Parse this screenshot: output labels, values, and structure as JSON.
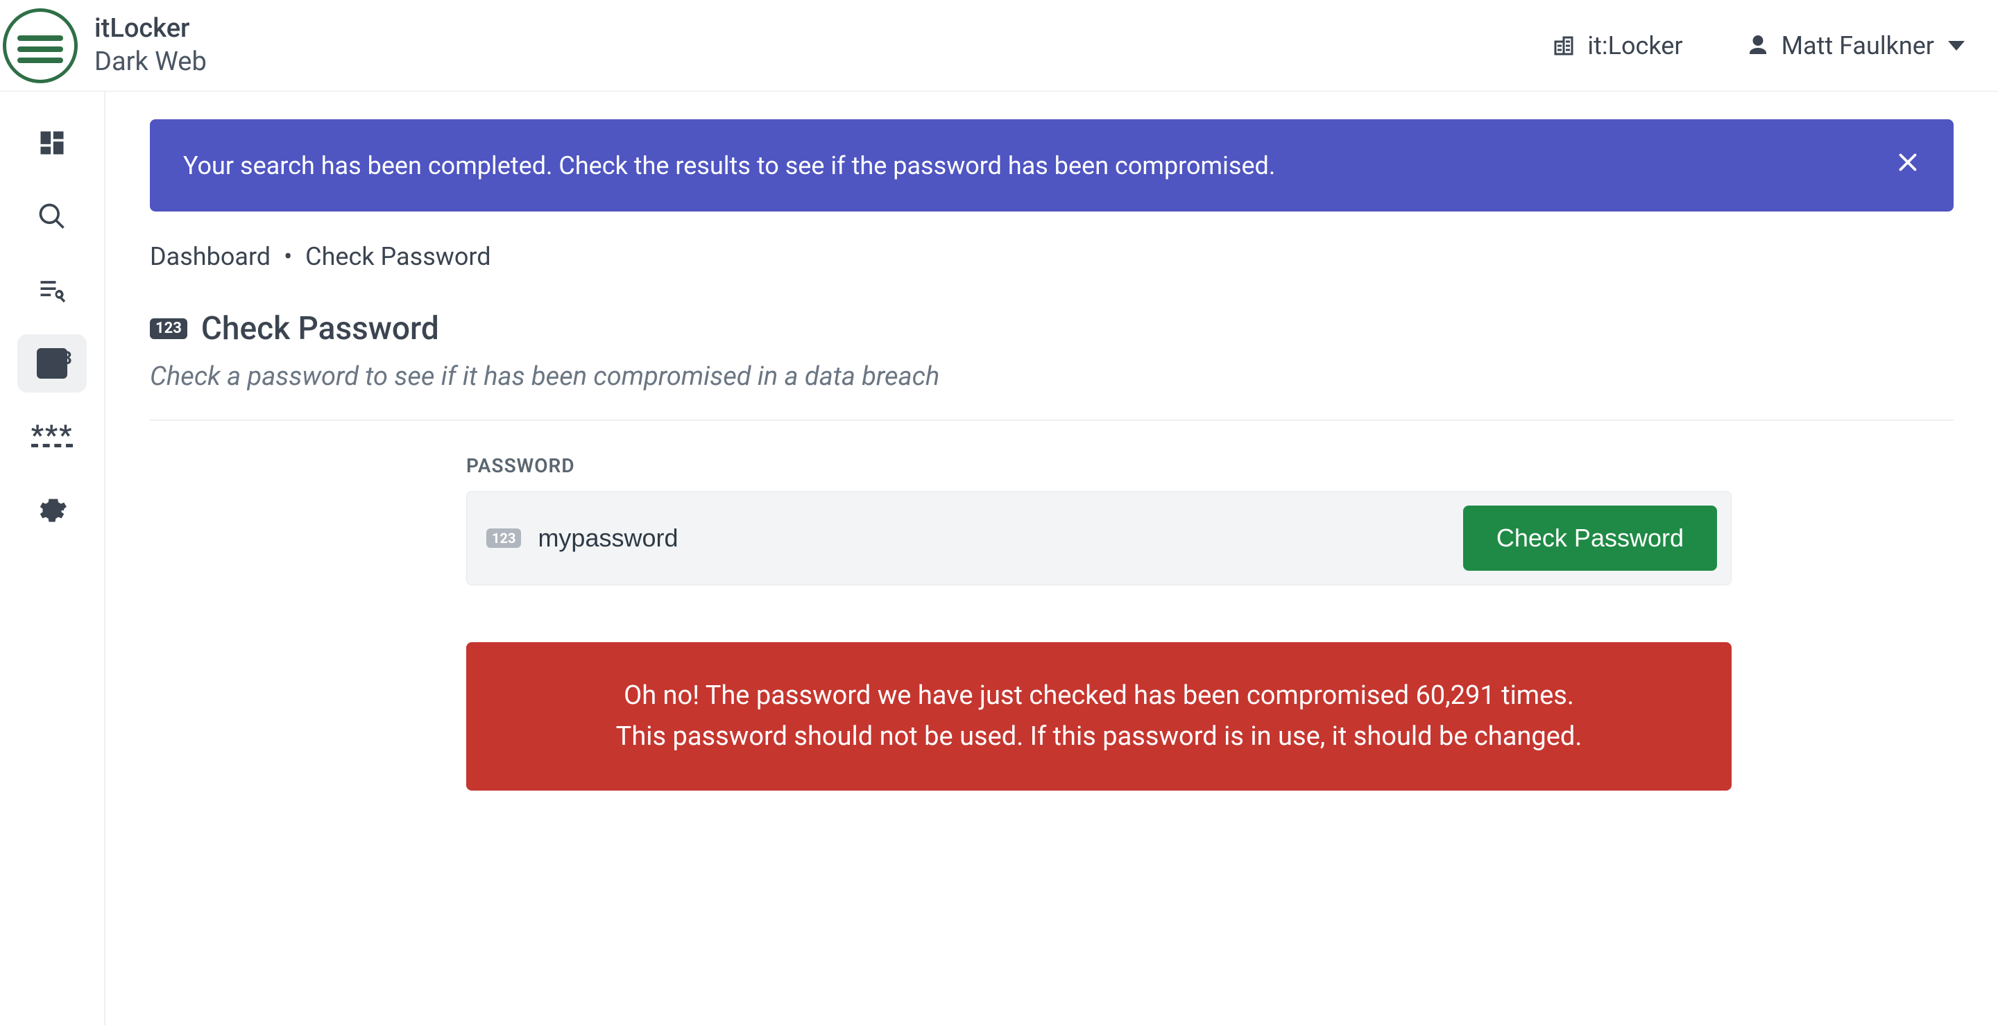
{
  "header": {
    "app_title": "itLocker",
    "subtitle": "Dark Web",
    "org_label": "it:Locker",
    "user_name": "Matt Faulkner"
  },
  "sidebar": {
    "items": [
      {
        "name": "dashboard",
        "active": false
      },
      {
        "name": "search",
        "active": false
      },
      {
        "name": "list-search",
        "active": false
      },
      {
        "name": "check-password",
        "active": true
      },
      {
        "name": "asterisks",
        "active": false
      },
      {
        "name": "settings",
        "active": false
      }
    ]
  },
  "banner": {
    "message": "Your search has been completed. Check the results to see if the password has been compromised."
  },
  "breadcrumb": {
    "root": "Dashboard",
    "separator": "•",
    "current": "Check Password"
  },
  "page": {
    "title": "Check Password",
    "description": "Check a password to see if it has been compromised in a data breach"
  },
  "form": {
    "password_label": "PASSWORD",
    "password_value": "mypassword",
    "password_placeholder": "",
    "submit_label": "Check Password"
  },
  "result": {
    "line1": "Oh no! The password we have just checked has been compromised 60,291 times.",
    "line2": "This password should not be used. If this password is in use, it should be changed."
  },
  "colors": {
    "banner_bg": "#4f55c1",
    "alert_bg": "#c5362f",
    "primary_btn": "#1f8a45"
  }
}
